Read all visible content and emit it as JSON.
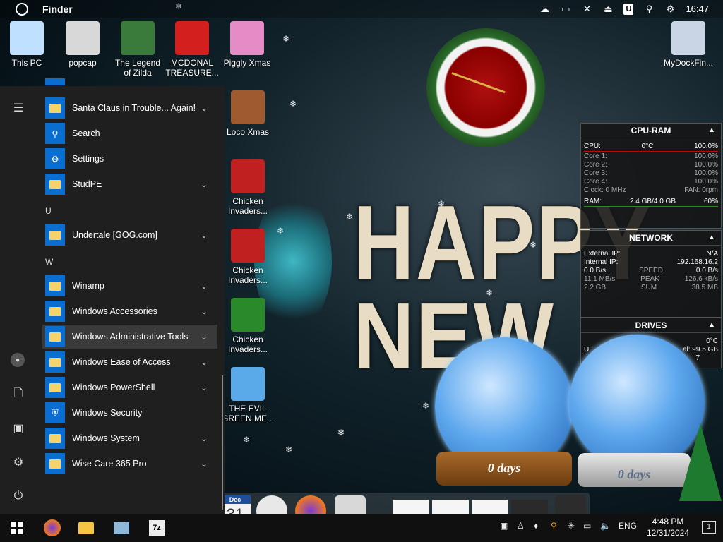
{
  "menubar": {
    "app_name": "Finder",
    "time": "16:47",
    "u_badge": "U"
  },
  "desktop_icons": [
    {
      "label": "This PC",
      "color": "#bfe0ff"
    },
    {
      "label": "popcap",
      "color": "#d8d8d8"
    },
    {
      "label": "The Legend of Zilda",
      "color": "#3a7a3a"
    },
    {
      "label": "MCDONAL TREASURE...",
      "color": "#d41f1f"
    },
    {
      "label": "Piggly Xmas",
      "color": "#e58cc6"
    },
    {
      "label": "MyDockFin...",
      "color": "#c9d5e5"
    },
    {
      "label": "Loco Xmas",
      "color": "#a05a30"
    },
    {
      "label": "Chicken Invaders...",
      "color": "#c02020"
    },
    {
      "label": "Chicken Invaders...",
      "color": "#c02020"
    },
    {
      "label": "Chicken Invaders...",
      "color": "#2a8a2a"
    },
    {
      "label": "THE EVIL GREEN ME...",
      "color": "#5aa9e8"
    }
  ],
  "banner": {
    "line1": "HAPPY",
    "line2": "NEW YE"
  },
  "cpu_ram": {
    "title": "CPU-RAM",
    "cpu_label": "CPU:",
    "cpu_temp": "0°C",
    "cpu_pct": "100.0%",
    "cores": [
      {
        "label": "Core 1:",
        "value": "100.0%"
      },
      {
        "label": "Core 2:",
        "value": "100.0%"
      },
      {
        "label": "Core 3:",
        "value": "100.0%"
      },
      {
        "label": "Core 4:",
        "value": "100.0%"
      }
    ],
    "clock": "Clock: 0 MHz",
    "fan": "FAN: 0rpm",
    "ram_label": "RAM:",
    "ram_value": "2.4 GB/4.0 GB",
    "ram_pct": "60%"
  },
  "network": {
    "title": "NETWORK",
    "external_label": "External IP:",
    "external_value": "N/A",
    "internal_label": "Internal IP:",
    "internal_value": "192.168.16.2",
    "speed_left": "0.0 B/s",
    "speed_label": "SPEED",
    "speed_right": "0.0 B/s",
    "peak_left": "11.1 MB/s",
    "peak_label": "PEAK",
    "peak_right": "126.6 kB/s",
    "sum_left": "2.2 GB",
    "sum_label": "SUM",
    "sum_right": "38.5 MB"
  },
  "drives": {
    "title": "DRIVES",
    "temp": "0°C",
    "free_fragment": "al: 99.5 GB",
    "drive_letter_fragment": "U",
    "seven_fragment": "7"
  },
  "globes": {
    "left_text": "0 days",
    "right_text": "0 days"
  },
  "start_menu": {
    "items": [
      {
        "label": "Santa Claus in Trouble... Again!",
        "type": "folder",
        "chevron": true
      },
      {
        "label": "Search",
        "type": "search",
        "chevron": false
      },
      {
        "label": "Settings",
        "type": "settings",
        "chevron": false
      },
      {
        "label": "StudPE",
        "type": "folder",
        "chevron": true
      },
      {
        "label": "Undertale [GOG.com]",
        "type": "folder",
        "chevron": true
      },
      {
        "label": "Winamp",
        "type": "folder",
        "chevron": true
      },
      {
        "label": "Windows Accessories",
        "type": "folder",
        "chevron": true
      },
      {
        "label": "Windows Administrative Tools",
        "type": "folder",
        "chevron": true,
        "active": true
      },
      {
        "label": "Windows Ease of Access",
        "type": "folder",
        "chevron": true
      },
      {
        "label": "Windows PowerShell",
        "type": "folder",
        "chevron": true
      },
      {
        "label": "Windows Security",
        "type": "shield",
        "chevron": false
      },
      {
        "label": "Windows System",
        "type": "folder",
        "chevron": true
      },
      {
        "label": "Wise Care 365 Pro",
        "type": "folder",
        "chevron": true
      }
    ],
    "letters": [
      "U",
      "W"
    ],
    "rail_icons": [
      "hamburger-icon",
      "user-icon",
      "document-icon",
      "pictures-icon",
      "settings-icon",
      "power-icon"
    ]
  },
  "dock": {
    "calendar_month": "Dec",
    "calendar_day": "31"
  },
  "taskbar": {
    "apps": [
      "windows-start-icon",
      "firefox-icon",
      "file-explorer-icon",
      "control-panel-icon",
      "7zip-icon"
    ],
    "language": "ENG",
    "time": "4:48 PM",
    "date": "12/31/2024",
    "notification_count": "1"
  }
}
